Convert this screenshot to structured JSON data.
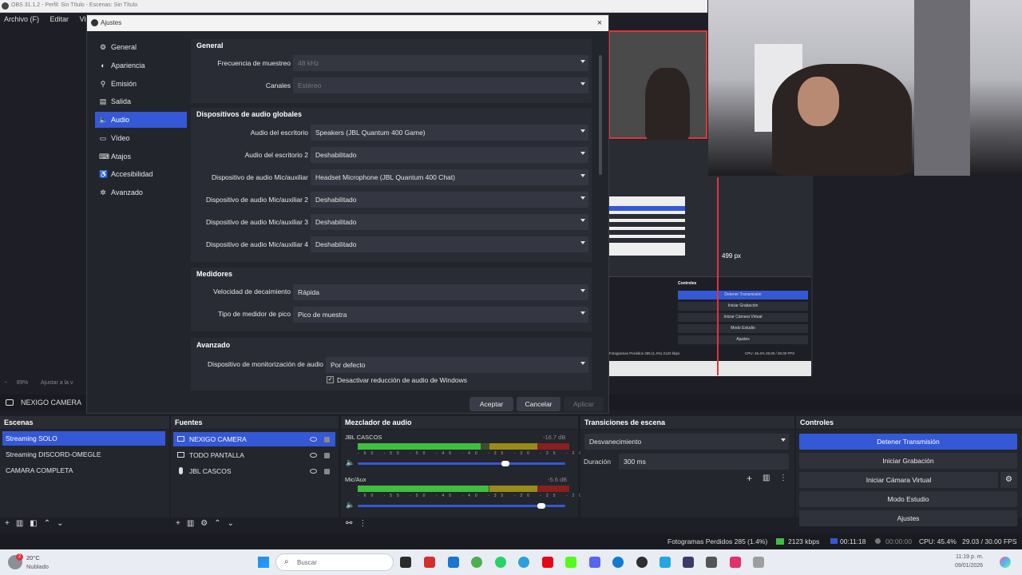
{
  "window_title": "OBS 31.1.2 - Perfil: Sin Título - Escenas: Sin Título",
  "menu": [
    "Archivo (F)",
    "Editar",
    "Vista"
  ],
  "zoom_bar": {
    "zoom": "89%",
    "fit": "Ajustar a la v"
  },
  "dialog": {
    "title": "Ajustes",
    "close": "×",
    "sidebar": [
      {
        "label": "General",
        "icon": "gear-icon",
        "glyph": "⚙"
      },
      {
        "label": "Apariencia",
        "icon": "palette-icon",
        "glyph": "◐"
      },
      {
        "label": "Emisión",
        "icon": "antenna-icon",
        "glyph": "⚲"
      },
      {
        "label": "Salida",
        "icon": "output-icon",
        "glyph": "▤"
      },
      {
        "label": "Audio",
        "icon": "speaker-icon",
        "glyph": "🔈"
      },
      {
        "label": "Vídeo",
        "icon": "monitor-icon",
        "glyph": "▭"
      },
      {
        "label": "Atajos",
        "icon": "keyboard-icon",
        "glyph": "⌨"
      },
      {
        "label": "Accesibilidad",
        "icon": "accessibility-icon",
        "glyph": "♿"
      },
      {
        "label": "Avanzado",
        "icon": "wrench-icon",
        "glyph": "✲"
      }
    ],
    "active_index": 4,
    "general": {
      "title": "General",
      "sample_rate_label": "Frecuencia de muestreo",
      "sample_rate_value": "48 kHz",
      "channels_label": "Canales",
      "channels_value": "Estéreo"
    },
    "global_devices": {
      "title": "Dispositivos de audio globales",
      "rows": [
        {
          "label": "Audio del escritorio",
          "value": "Speakers (JBL Quantum 400 Game)"
        },
        {
          "label": "Audio del escritorio 2",
          "value": "Deshabilitado"
        },
        {
          "label": "Dispositivo de audio Mic/auxiliar",
          "value": "Headset Microphone (JBL Quantum 400 Chat)"
        },
        {
          "label": "Dispositivo de audio Mic/auxiliar 2",
          "value": "Deshabilitado"
        },
        {
          "label": "Dispositivo de audio Mic/auxiliar 3",
          "value": "Deshabilitado"
        },
        {
          "label": "Dispositivo de audio Mic/auxiliar 4",
          "value": "Deshabilitado"
        }
      ]
    },
    "meters": {
      "title": "Medidores",
      "decay_label": "Velocidad de decaimiento",
      "decay_value": "Rápida",
      "peak_label": "Tipo de medidor de pico",
      "peak_value": "Pico de muestra"
    },
    "advanced": {
      "title": "Avanzado",
      "monitor_label": "Dispositivo de monitorización de audio",
      "monitor_value": "Por defecto",
      "ducking_label": "Desactivar reducción de audio de Windows",
      "ducking_checked": true
    },
    "buttons": {
      "ok": "Aceptar",
      "cancel": "Cancelar",
      "apply": "Aplicar"
    }
  },
  "preview": {
    "size_label": "499 px",
    "nested_controls_title": "Controles",
    "nested_buttons": [
      "Detener Transmisión",
      "Iniciar Grabación",
      "Iniciar Cámara Virtual",
      "Modo Estudio",
      "Ajustes"
    ],
    "nested_status": "Fotogramas Perdidos 285 (1.4%)  2123 kbps",
    "nested_status_right": "CPU: 45.4%  29.00 / 30.00 FPS"
  },
  "source_bar": {
    "label": "NEXIGO CAMERA"
  },
  "scenes": {
    "title": "Escenas",
    "items": [
      "Streaming SOLO",
      "Streaming DISCORD-OMEGLE",
      "CAMARA COMPLETA"
    ],
    "selected": 0
  },
  "sources": {
    "title": "Fuentes",
    "items": [
      {
        "label": "NEXIGO CAMERA",
        "icon": "camera-icon"
      },
      {
        "label": "TODO PANTALLA",
        "icon": "monitor-icon"
      },
      {
        "label": "JBL CASCOS",
        "icon": "microphone-icon"
      }
    ],
    "selected": 0
  },
  "mixer": {
    "title": "Mezclador de audio",
    "tracks": [
      {
        "name": "JBL CASCOS",
        "db": "-16.7 dB",
        "level": 0.58,
        "volume": 0.72
      },
      {
        "name": "Mic/Aux",
        "db": "-5.6 dB",
        "level": 0.79,
        "volume": 0.9
      }
    ],
    "ticks": "-60 -55 -50 -45 -40 -35 -30 -25 -20 -15 -10 -5 0"
  },
  "transitions": {
    "title": "Transiciones de escena",
    "type": "Desvanecimiento",
    "duration_label": "Duración",
    "duration_value": "300 ms"
  },
  "controls": {
    "title": "Controles",
    "buttons": [
      "Detener Transmisión",
      "Iniciar Grabación",
      "Iniciar Cámara Virtual",
      "Modo Estudio",
      "Ajustes"
    ]
  },
  "status": {
    "dropped": "Fotogramas Perdidos 285 (1.4%)",
    "bitrate": "2123 kbps",
    "stream_time": "00:11:18",
    "rec_time": "00:00:00",
    "cpu": "CPU: 45.4%",
    "fps": "29.03 / 30.00 FPS"
  },
  "taskbar": {
    "weather_temp": "20°C",
    "weather_desc": "Nublado",
    "notif_count": "2",
    "search_placeholder": "Buscar",
    "time": "11:19 p. m.",
    "date": "09/01/2026"
  },
  "colors": {
    "accent": "#3458d6",
    "red": "#e0343a",
    "panel": "#24262e"
  }
}
